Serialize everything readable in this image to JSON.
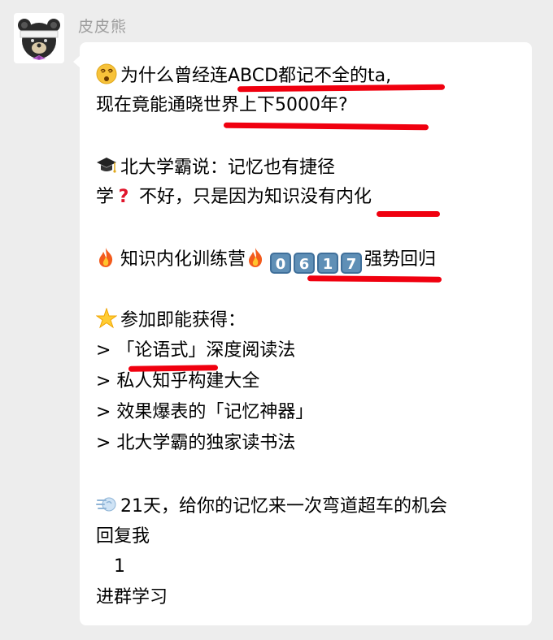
{
  "sender": {
    "name": "皮皮熊"
  },
  "icons": {
    "avatar": "bear-avatar",
    "dizzy_face": "dizzy-face-emoji",
    "graduation_cap": "graduation-cap-emoji",
    "red_question": "red-question-mark-emoji",
    "fire": "fire-emoji",
    "star": "glowing-star-emoji",
    "dash": "dash-emoji"
  },
  "colors": {
    "accent_underline": "#f0000f",
    "keycap_blue": "#5f8fb6"
  },
  "message": {
    "line1": "为什么曾经连ABCD都记不全的ta,",
    "line2": "现在竟能通晓世界上下5000年?",
    "line3": "北大学霸说：记忆也有捷径",
    "line4a": "学",
    "line4b": " 不好，只是因为知识没有内化",
    "line5a": "知识内化训练营",
    "keycaps": [
      "0",
      "6",
      "1",
      "7"
    ],
    "line5b": "强势回归",
    "line6": "参加即能获得：",
    "bullet1": ">  「论语式」深度阅读法",
    "bullet2": ">   私人知乎构建大全",
    "bullet3": ">   效果爆表的「记忆神器」",
    "bullet4": ">   北大学霸的独家读书法",
    "line7": "21天，给你的记忆来一次弯道超车的机会",
    "line8": "回复我",
    "line9": "1",
    "line10": "进群学习"
  }
}
